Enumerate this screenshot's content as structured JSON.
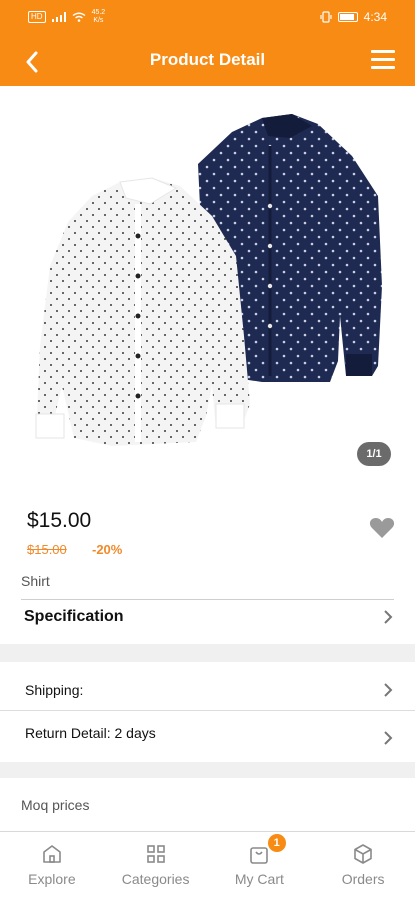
{
  "status_bar": {
    "left_badge": "HD",
    "speed": "45.2\nK/s",
    "time": "4:34"
  },
  "app_bar": {
    "title": "Product Detail",
    "back_icon": "chevron-left-icon",
    "menu_icon": "hamburger-menu-icon"
  },
  "gallery": {
    "counter": "1/1",
    "image": "two polka-dot dress shirts, white and navy"
  },
  "product": {
    "price": "$15.00",
    "old_price": "$15.00",
    "discount": "-20%",
    "name": "Shirt",
    "wishlist_icon": "heart-icon"
  },
  "rows": {
    "specification": "Specification",
    "shipping": "Shipping:",
    "return_detail": "Return Detail: 2 days",
    "moq_prices": "Moq prices"
  },
  "bottom_nav": {
    "items": [
      {
        "label": "Explore",
        "icon": "home-icon"
      },
      {
        "label": "Categories",
        "icon": "grid-icon"
      },
      {
        "label": "My Cart",
        "icon": "shopping-bag-icon",
        "badge": "1"
      },
      {
        "label": "Orders",
        "icon": "box-icon"
      }
    ]
  },
  "colors": {
    "accent": "#f78b14",
    "discount": "#f08a2a",
    "badge_gray": "#6b6b6b"
  }
}
